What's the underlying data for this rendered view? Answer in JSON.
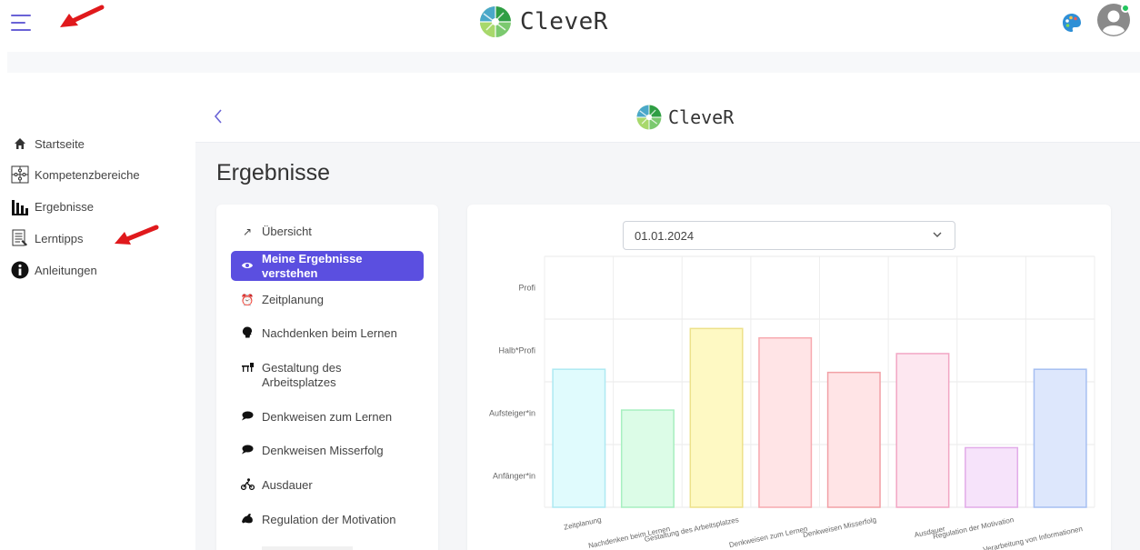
{
  "app": {
    "brand": "CleveR",
    "colors": {
      "accent": "#5b4fe0",
      "hamburger": "#6a63d6",
      "annotation_arrow": "#e0191c",
      "status_online": "#22c55e"
    }
  },
  "topbar": {
    "menu_icon": "hamburger-icon",
    "palette_icon": "palette-icon",
    "avatar_icon": "user-avatar-icon"
  },
  "sidebar": {
    "items": [
      {
        "label": "Startseite",
        "icon": "home-icon"
      },
      {
        "label": "Kompetenzbereiche",
        "icon": "puzzle-icon"
      },
      {
        "label": "Ergebnisse",
        "icon": "bar-chart-icon"
      },
      {
        "label": "Lerntipps",
        "icon": "document-icon"
      },
      {
        "label": "Anleitungen",
        "icon": "info-icon"
      }
    ]
  },
  "main": {
    "back_icon": "chevron-left-icon",
    "brand": "CleveR",
    "title": "Ergebnisse",
    "menu": [
      {
        "label": "Übersicht",
        "icon": "trending-icon",
        "active": false
      },
      {
        "label": "Meine Ergebnisse verstehen",
        "icon": "eye-icon",
        "active": true
      },
      {
        "label": "Zeitplanung",
        "icon": "alarm-clock-icon",
        "active": false
      },
      {
        "label": "Nachdenken beim Lernen",
        "icon": "head-icon",
        "active": false
      },
      {
        "label": "Gestaltung des Arbeitsplatzes",
        "icon": "desk-icon",
        "active": false
      },
      {
        "label": "Denkweisen zum Lernen",
        "icon": "speech-cloud-icon",
        "active": false
      },
      {
        "label": "Denkweisen Misserfolg",
        "icon": "speech-cloud-icon",
        "active": false
      },
      {
        "label": "Ausdauer",
        "icon": "cyclist-icon",
        "active": false
      },
      {
        "label": "Regulation der Motivation",
        "icon": "muscle-icon",
        "active": false
      }
    ],
    "date_select": {
      "value": "01.01.2024"
    }
  },
  "chart_data": {
    "type": "bar",
    "categories": [
      "Zeitplanung",
      "Nachdenken beim Lernen",
      "Gestaltung des Arbeitsplatzes",
      "Denkweisen zum Lernen",
      "Denkweisen Misserfolg",
      "Ausdauer",
      "Regulation der Motivation",
      "Verarbeitung von Informationen"
    ],
    "values": [
      2.2,
      1.55,
      2.85,
      2.7,
      2.15,
      2.45,
      0.95,
      2.2
    ],
    "y_ticks": [
      "Anfänger*in",
      "Aufsteiger*in",
      "Halb*Profi",
      "Profi"
    ],
    "ylim": [
      0,
      4
    ],
    "grid": true,
    "bar_fill": [
      "#e0fbfd",
      "#dcfce7",
      "#fef9c3",
      "#ffe4e6",
      "#ffe4e6",
      "#fde7f0",
      "#f6e3fa",
      "#dde7fc"
    ],
    "bar_stroke": [
      "#aee9f2",
      "#a7efc0",
      "#ede18a",
      "#f7a9af",
      "#f2a0a6",
      "#f2a6c4",
      "#e2abe9",
      "#a6bff2"
    ]
  }
}
